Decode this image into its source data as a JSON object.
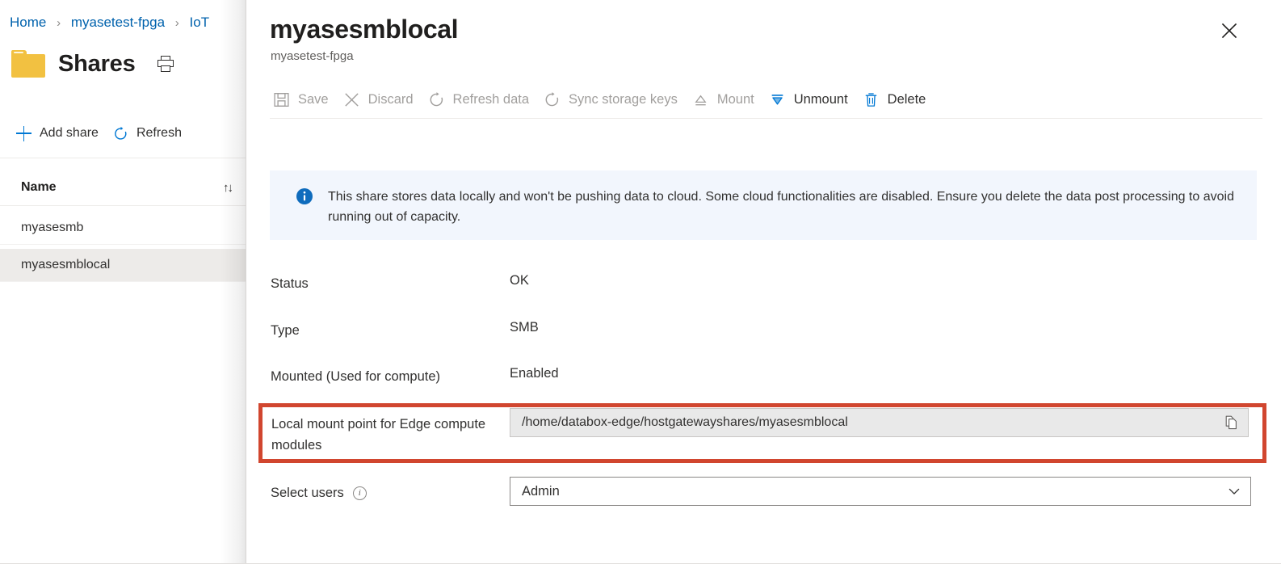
{
  "left_blade": {
    "breadcrumb": [
      {
        "label": "Home",
        "icon": ""
      },
      {
        "label": "myasetest-fpga",
        "icon": ""
      },
      {
        "label": "IoT",
        "icon": ""
      }
    ],
    "breadcrumb_separator": "›",
    "title": "Shares",
    "folder_icon": "folder-icon",
    "print_icon": "print-icon",
    "commands": [
      {
        "label": "Add share",
        "icon": "plus-icon"
      },
      {
        "label": "Refresh",
        "icon": "refresh-icon"
      }
    ],
    "list": {
      "column_header": "Name",
      "sort_icon": "↑↓",
      "rows": [
        {
          "name": "myasesmb",
          "selected": false
        },
        {
          "name": "myasesmblocal",
          "selected": true
        }
      ]
    }
  },
  "detail_blade": {
    "title": "myasesmblocal",
    "subtitle": "myasetest-fpga",
    "close_icon": "close-icon",
    "toolbar": [
      {
        "label": "Save",
        "icon": "save-icon",
        "enabled": false
      },
      {
        "label": "Discard",
        "icon": "discard-icon",
        "enabled": false
      },
      {
        "label": "Refresh data",
        "icon": "refresh-icon",
        "enabled": false
      },
      {
        "label": "Sync storage keys",
        "icon": "sync-icon",
        "enabled": false
      },
      {
        "label": "Mount",
        "icon": "mount-icon",
        "enabled": false
      },
      {
        "label": "Unmount",
        "icon": "unmount-icon",
        "enabled": true
      },
      {
        "label": "Delete",
        "icon": "trash-icon",
        "enabled": true
      }
    ],
    "banner": {
      "icon": "info-icon",
      "text": "This share stores data locally and won't be pushing data to cloud. Some cloud functionalities are disabled. Ensure you delete the data post processing to avoid running out of capacity.",
      "background": "#f2f6fd",
      "icon_color": "#0078d4"
    },
    "properties": {
      "status": {
        "label": "Status",
        "value": "OK"
      },
      "type": {
        "label": "Type",
        "value": "SMB"
      },
      "mounted": {
        "label": "Mounted (Used for compute)",
        "value": "Enabled"
      },
      "mount_point": {
        "label": "Local mount point for Edge compute modules",
        "value": "/home/databox-edge/hostgatewayshares/myasesmblocal",
        "copy_icon": "copy-icon",
        "readonly": true,
        "highlight_color": "#d1462f"
      },
      "select_users": {
        "label": "Select users",
        "info_icon": "info-circle-icon",
        "value": "Admin",
        "chevron_icon": "chevron-down-icon"
      }
    }
  },
  "theme": {
    "accent": "#0078d4",
    "link": "#0062ad",
    "disabled_text": "#a19f9d",
    "text": "#323130",
    "highlight_red": "#d1462f",
    "folder_yellow": "#f2c141",
    "selected_row": "#edebe9"
  }
}
